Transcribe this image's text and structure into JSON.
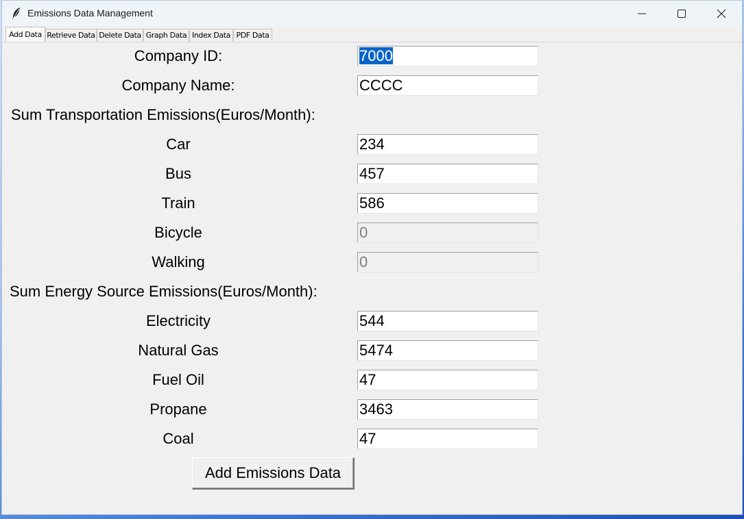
{
  "window": {
    "title": "Emissions Data Management",
    "icon": "feather-icon"
  },
  "tabs": [
    {
      "label": "Add Data",
      "active": true
    },
    {
      "label": "Retrieve Data",
      "active": false
    },
    {
      "label": "Delete Data",
      "active": false
    },
    {
      "label": "Graph Data",
      "active": false
    },
    {
      "label": "Index Data",
      "active": false
    },
    {
      "label": "PDF Data",
      "active": false
    }
  ],
  "form": {
    "company_id": {
      "label": "Company ID:",
      "value": "7000",
      "selected": true
    },
    "company_name": {
      "label": "Company Name:",
      "value": "CCCC"
    },
    "transport_heading": "Sum Transportation Emissions(Euros/Month):",
    "transport": [
      {
        "label": "Car",
        "value": "234",
        "enabled": true
      },
      {
        "label": "Bus",
        "value": "457",
        "enabled": true
      },
      {
        "label": "Train",
        "value": "586",
        "enabled": true
      },
      {
        "label": "Bicycle",
        "value": "0",
        "enabled": false
      },
      {
        "label": "Walking",
        "value": "0",
        "enabled": false
      }
    ],
    "energy_heading": "Sum Energy Source Emissions(Euros/Month):",
    "energy": [
      {
        "label": "Electricity",
        "value": "544"
      },
      {
        "label": "Natural Gas",
        "value": "5474"
      },
      {
        "label": "Fuel Oil",
        "value": "47"
      },
      {
        "label": "Propane",
        "value": "3463"
      },
      {
        "label": "Coal",
        "value": "47"
      }
    ],
    "submit_label": "Add Emissions Data"
  }
}
